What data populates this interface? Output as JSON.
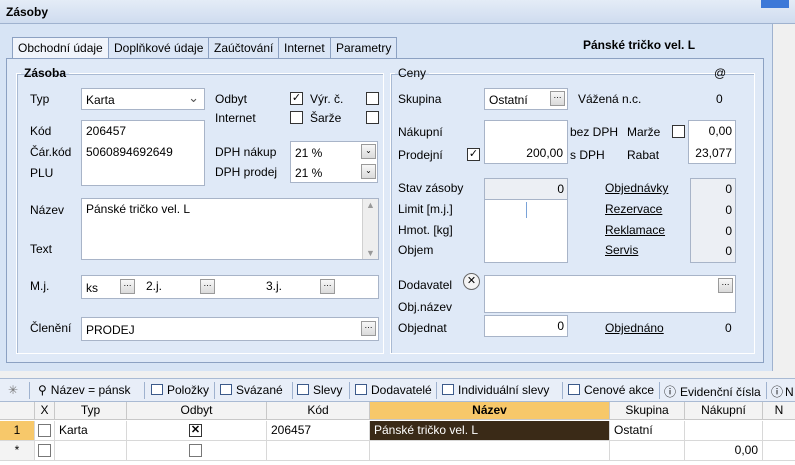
{
  "window": {
    "title": "Zásoby"
  },
  "tabs": [
    "Obchodní údaje",
    "Doplňkové údaje",
    "Zaúčtování",
    "Internet",
    "Parametry"
  ],
  "product_title": "Pánské tričko vel. L",
  "zasoba": {
    "legend": "Zásoba",
    "typ_label": "Typ",
    "typ_value": "Karta",
    "kod_label": "Kód",
    "kod_value": "206457",
    "car_kod_label": "Čár.kód",
    "car_kod_value": "5060894692649",
    "plu_label": "PLU",
    "odbyt_label": "Odbyt",
    "vyr_c_label": "Výr. č.",
    "internet_label": "Internet",
    "sarze_label": "Šarže",
    "dph_nakup_label": "DPH nákup",
    "dph_nakup_value": "21 %",
    "dph_prodej_label": "DPH prodej",
    "dph_prodej_value": "21 %",
    "nazev_label": "Název",
    "nazev_value": "Pánské tričko vel. L",
    "text_label": "Text",
    "mj_label": "M.j.",
    "mj_value": "ks",
    "mj2_label": "2.j.",
    "mj3_label": "3.j.",
    "cleneni_label": "Členění",
    "cleneni_value": "PRODEJ"
  },
  "ceny": {
    "legend": "Ceny",
    "at": "@",
    "skupina_label": "Skupina",
    "skupina_value": "Ostatní",
    "vazena_label": "Vážená n.c.",
    "vazena_value": "0",
    "nakupni_label": "Nákupní",
    "bez_dph_label": "bez DPH",
    "marze_label": "Marže",
    "marze_value": "0,00",
    "prodejni_label": "Prodejní",
    "prodejni_value": "200,00",
    "s_dph_label": "s DPH",
    "rabat_label": "Rabat",
    "rabat_value": "23,077",
    "stav_label": "Stav zásoby",
    "stav_value": "0",
    "limit_label": "Limit  [m.j.]",
    "hmot_label": "Hmot. [kg]",
    "objem_label": "Objem",
    "objednavky_label": "Objednávky",
    "objednavky_value": "0",
    "rezervace_label": "Rezervace",
    "rezervace_value": "0",
    "reklamace_label": "Reklamace",
    "reklamace_value": "0",
    "servis_label": "Servis",
    "servis_value": "0",
    "dodavatel_label": "Dodavatel",
    "obj_nazev_label": "Obj.název",
    "objednat_label": "Objednat",
    "objednat_value": "0",
    "objednano_label": "Objednáno",
    "objednano_value": "0"
  },
  "bottom_tabs": [
    "Název = pánsk",
    "Položky",
    "Svázané",
    "Slevy",
    "Dodavatelé",
    "Individuální slevy",
    "Cenové akce",
    "Evidenční čísla",
    "N"
  ],
  "grid": {
    "headers": [
      "X",
      "Typ",
      "Odbyt",
      "Kód",
      "Název",
      "Skupina",
      "Nákupní",
      "N"
    ],
    "row1": {
      "num": "1",
      "typ": "Karta",
      "kod": "206457",
      "nazev": "Pánské tričko vel. L",
      "skupina": "Ostatní"
    },
    "row2": {
      "marker": "*",
      "nakupni": "0,00"
    }
  }
}
